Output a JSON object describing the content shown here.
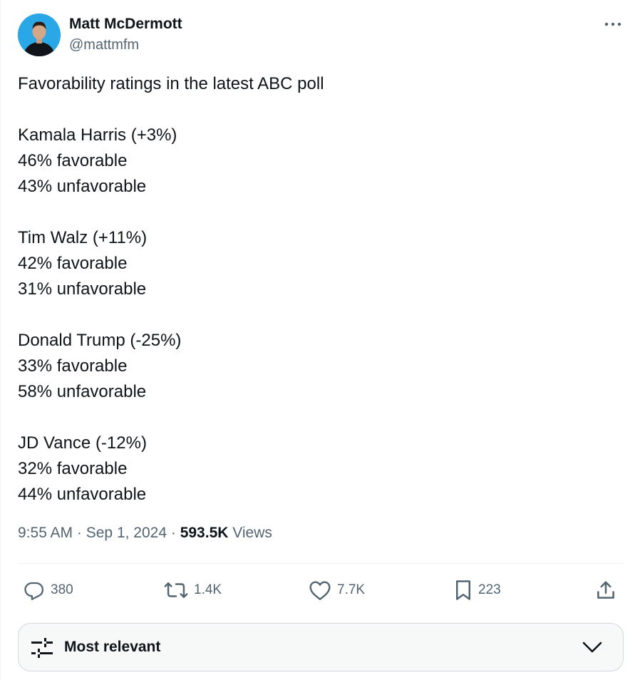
{
  "author": {
    "name": "Matt McDermott",
    "handle": "@mattmfm"
  },
  "tweet": {
    "lines": [
      "Favorability ratings in the latest ABC poll",
      "",
      "Kamala Harris (+3%)",
      "46% favorable",
      "43% unfavorable",
      "",
      "Tim Walz (+11%)",
      "42% favorable",
      "31% unfavorable",
      "",
      "Donald Trump (-25%)",
      "33% favorable",
      "58% unfavorable",
      "",
      "JD Vance (-12%)",
      "32% favorable",
      "44% unfavorable"
    ]
  },
  "meta": {
    "time": "9:55 AM",
    "separator": "·",
    "date": "Sep 1, 2024",
    "views_count": "593.5K",
    "views_label": "Views"
  },
  "actions": {
    "replies": "380",
    "reposts": "1.4K",
    "likes": "7.7K",
    "bookmarks": "223"
  },
  "sort": {
    "label": "Most relevant"
  },
  "icons": {
    "more": "more-icon",
    "reply": "reply-icon",
    "repost": "repost-icon",
    "like": "heart-icon",
    "bookmark": "bookmark-icon",
    "share": "share-icon",
    "sort": "sliders-icon",
    "chevron": "chevron-down-icon"
  },
  "colors": {
    "text": "#0f1419",
    "secondary": "#536471",
    "avatar_bg": "#2aa7e6",
    "border": "#cfd9de"
  }
}
